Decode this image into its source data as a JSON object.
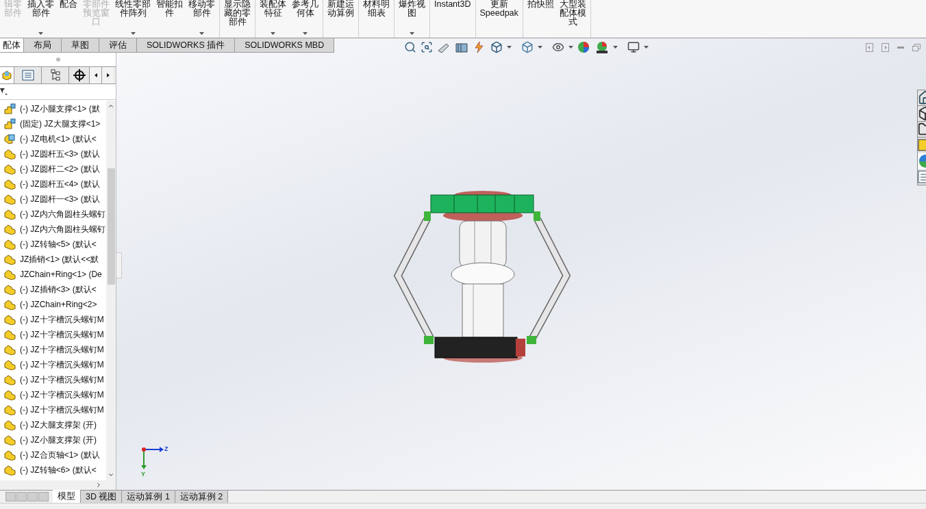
{
  "ribbon": {
    "groups": [
      [
        {
          "lines": [
            "辑零",
            "部件"
          ],
          "disabled": true,
          "dropdown": false
        },
        {
          "lines": [
            "插入零",
            "部件"
          ],
          "disabled": false,
          "dropdown": true
        },
        {
          "lines": [
            "配合"
          ],
          "disabled": false,
          "dropdown": false
        },
        {
          "lines": [
            "零部件",
            "预览窗",
            "口"
          ],
          "disabled": true,
          "dropdown": false
        },
        {
          "lines": [
            "线性零部",
            "件阵列"
          ],
          "disabled": false,
          "dropdown": true
        },
        {
          "lines": [
            "智能扣",
            "件"
          ],
          "disabled": false,
          "dropdown": false
        },
        {
          "lines": [
            "移动零",
            "部件"
          ],
          "disabled": false,
          "dropdown": true
        }
      ],
      [
        {
          "lines": [
            "显示隐",
            "藏的零",
            "部件"
          ],
          "disabled": false,
          "dropdown": false
        }
      ],
      [
        {
          "lines": [
            "装配体",
            "特征"
          ],
          "disabled": false,
          "dropdown": true
        },
        {
          "lines": [
            "参考几",
            "何体"
          ],
          "disabled": false,
          "dropdown": true
        }
      ],
      [
        {
          "lines": [
            "新建运",
            "动算例"
          ],
          "disabled": false,
          "dropdown": false
        }
      ],
      [
        {
          "lines": [
            "材料明",
            "细表"
          ],
          "disabled": false,
          "dropdown": false
        }
      ],
      [
        {
          "lines": [
            "爆炸视",
            "图"
          ],
          "disabled": false,
          "dropdown": true
        }
      ],
      [
        {
          "lines": [
            "Instant3D"
          ],
          "disabled": false,
          "dropdown": false
        }
      ],
      [
        {
          "lines": [
            "更新",
            "Speedpak"
          ],
          "disabled": false,
          "dropdown": false
        }
      ],
      [
        {
          "lines": [
            "拍快照"
          ],
          "disabled": false,
          "dropdown": false
        },
        {
          "lines": [
            "大型装",
            "配体模",
            "式"
          ],
          "disabled": false,
          "dropdown": false
        }
      ]
    ]
  },
  "command_tabs": [
    {
      "label": "配体",
      "selected": true
    },
    {
      "label": "布局",
      "selected": false
    },
    {
      "label": "草图",
      "selected": false
    },
    {
      "label": "评估",
      "selected": false
    },
    {
      "label": "SOLIDWORKS 插件",
      "selected": false
    },
    {
      "label": "SOLIDWORKS MBD",
      "selected": false
    }
  ],
  "feature_tree": {
    "items": [
      {
        "label": "(-) JZ小腿支撑<1> (默",
        "kind": "subassembly"
      },
      {
        "label": "(固定) JZ大腿支撑<1>",
        "kind": "subassembly"
      },
      {
        "label": "(-) JZ电机<1> (默认<",
        "kind": "part_blue"
      },
      {
        "label": "(-) JZ圆杆五<3> (默认",
        "kind": "part"
      },
      {
        "label": "(-) JZ圆杆二<2> (默认",
        "kind": "part"
      },
      {
        "label": "(-) JZ圆杆五<4> (默认",
        "kind": "part"
      },
      {
        "label": "(-) JZ圆杆一<3> (默认",
        "kind": "part"
      },
      {
        "label": "(-) JZ内六角圆柱头螺钉",
        "kind": "part"
      },
      {
        "label": "(-) JZ内六角圆柱头螺钉",
        "kind": "part"
      },
      {
        "label": "(-) JZ转轴<5> (默认<",
        "kind": "part"
      },
      {
        "label": "JZ插销<1> (默认<<默",
        "kind": "part"
      },
      {
        "label": "JZChain+Ring<1> (De",
        "kind": "part"
      },
      {
        "label": "(-) JZ插销<3> (默认<",
        "kind": "part"
      },
      {
        "label": "(-) JZChain+Ring<2>",
        "kind": "part"
      },
      {
        "label": "(-) JZ十字槽沉头螺钉M",
        "kind": "part"
      },
      {
        "label": "(-) JZ十字槽沉头螺钉M",
        "kind": "part"
      },
      {
        "label": "(-) JZ十字槽沉头螺钉M",
        "kind": "part"
      },
      {
        "label": "(-) JZ十字槽沉头螺钉M",
        "kind": "part"
      },
      {
        "label": "(-) JZ十字槽沉头螺钉M",
        "kind": "part"
      },
      {
        "label": "(-) JZ十字槽沉头螺钉M",
        "kind": "part"
      },
      {
        "label": "(-) JZ十字槽沉头螺钉M",
        "kind": "part"
      },
      {
        "label": "(-) JZ大腿支撑架 (开)",
        "kind": "part"
      },
      {
        "label": "(-) JZ小腿支撑架 (开)",
        "kind": "part"
      },
      {
        "label": "(-) JZ合页轴<1> (默认",
        "kind": "part"
      },
      {
        "label": "(-) JZ转轴<6> (默认<",
        "kind": "part"
      }
    ]
  },
  "triad": {
    "axes": [
      {
        "label": "Z",
        "kind": "z"
      },
      {
        "label": "Y",
        "kind": "y"
      }
    ]
  },
  "bottom_tabs": [
    {
      "label": "模型",
      "selected": true
    },
    {
      "label": "3D 视图",
      "selected": false
    },
    {
      "label": "运动算例 1",
      "selected": false
    },
    {
      "label": "运动算例 2",
      "selected": false
    }
  ]
}
